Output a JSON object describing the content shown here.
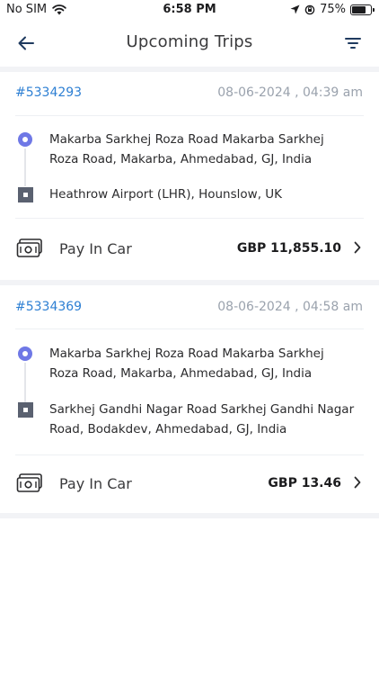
{
  "status_bar": {
    "carrier": "No SIM",
    "time": "6:58 PM",
    "battery": "75%",
    "battery_level": 0.75
  },
  "header": {
    "title": "Upcoming Trips"
  },
  "trips": [
    {
      "id": "#5334293",
      "datetime": "08-06-2024 , 04:39 am",
      "pickup": "Makarba Sarkhej Roza Road Makarba Sarkhej Roza Road, Makarba, Ahmedabad, GJ, India",
      "dropoff": "Heathrow Airport (LHR), Hounslow, UK",
      "payment_label": "Pay In Car",
      "fare": "GBP 11,855.10"
    },
    {
      "id": "#5334369",
      "datetime": "08-06-2024 , 04:58 am",
      "pickup": "Makarba Sarkhej Roza Road Makarba Sarkhej Roza Road, Makarba, Ahmedabad, GJ, India",
      "dropoff": "Sarkhej Gandhi Nagar Road Sarkhej Gandhi Nagar Road, Bodakdev, Ahmedabad, GJ, India",
      "payment_label": "Pay In Car",
      "fare": "GBP 13.46"
    }
  ],
  "colors": {
    "trip_id": "#2d7fd3",
    "pickup_marker": "#6f78e6",
    "dropoff_marker": "#5a6170",
    "date_text": "#9aa2ad"
  }
}
